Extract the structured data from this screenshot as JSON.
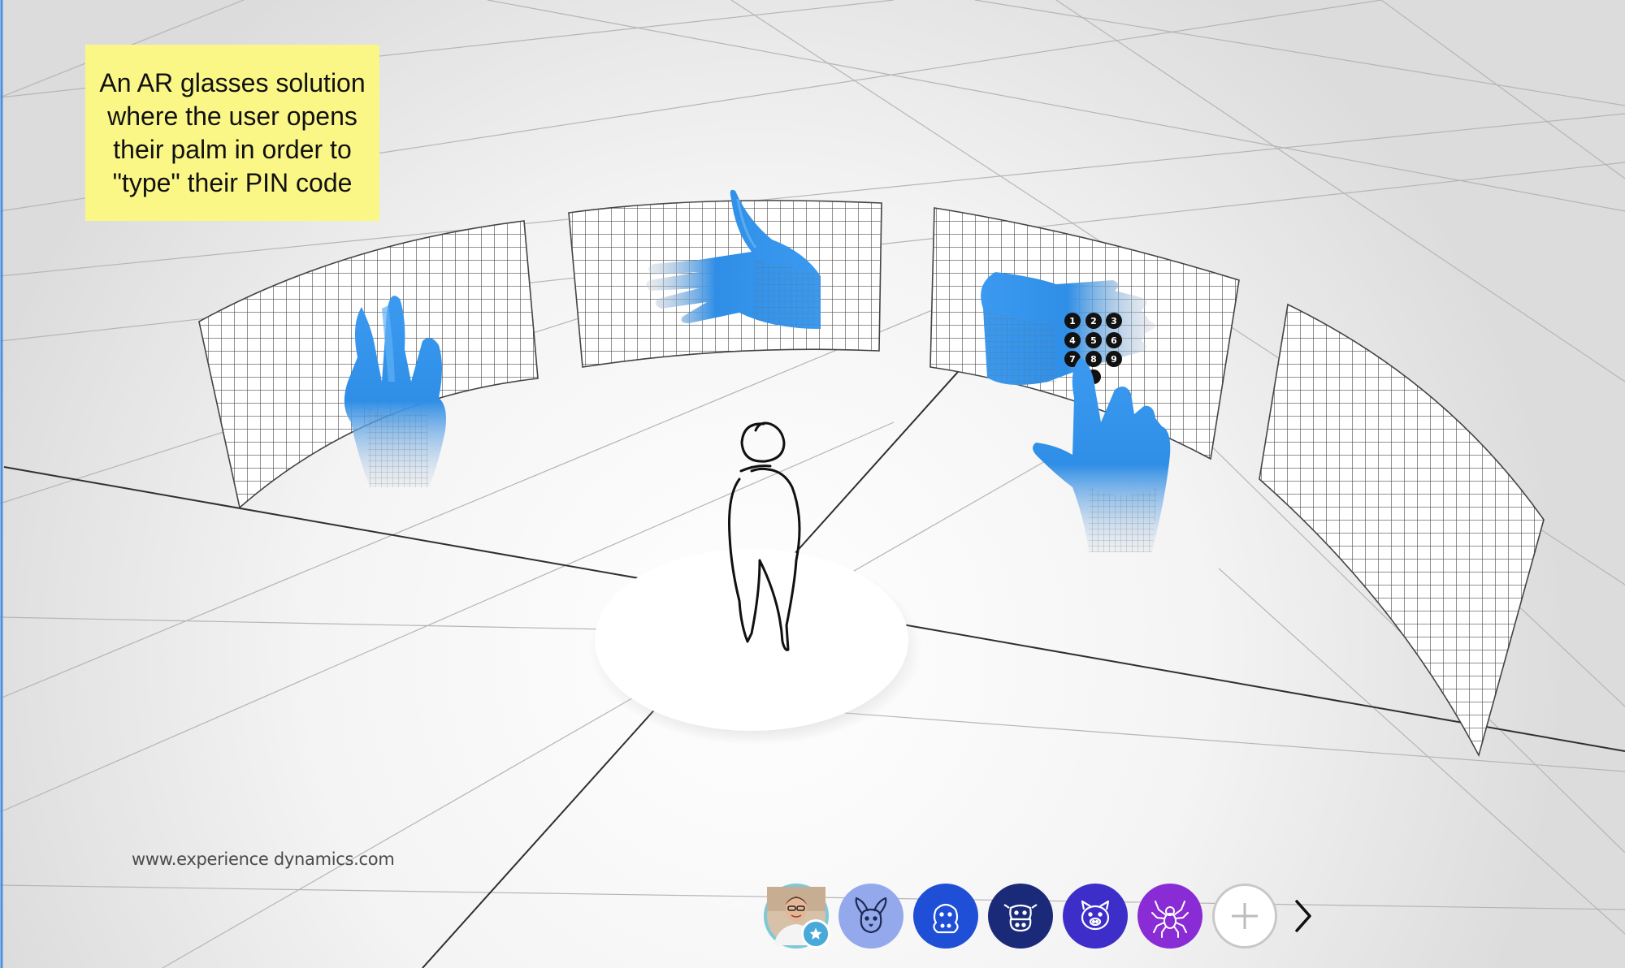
{
  "note": {
    "text": "An AR glasses solution where the user opens their palm in order to \"type\" their PIN code"
  },
  "footer": {
    "website": "www.experience dynamics.com"
  },
  "keypad": {
    "digits": [
      "1",
      "2",
      "3",
      "4",
      "5",
      "6",
      "7",
      "8",
      "9"
    ]
  },
  "toolbar": {
    "avatars": [
      {
        "name": "user-avatar",
        "color": "#7ec8d9"
      },
      {
        "name": "rabbit-icon",
        "color": "#93a9ec"
      },
      {
        "name": "hippo-icon",
        "color": "#1f4fd6"
      },
      {
        "name": "cow-icon",
        "color": "#1b2a78"
      },
      {
        "name": "pig-icon",
        "color": "#3d2ec9"
      },
      {
        "name": "spider-icon",
        "color": "#8a2cd6"
      }
    ],
    "add_icon": "plus-icon",
    "next_icon": "chevron-right-icon"
  },
  "colors": {
    "hand": "#2f8ee6",
    "sticky_note": "#fbf787",
    "floor": "#f4f4f4"
  }
}
